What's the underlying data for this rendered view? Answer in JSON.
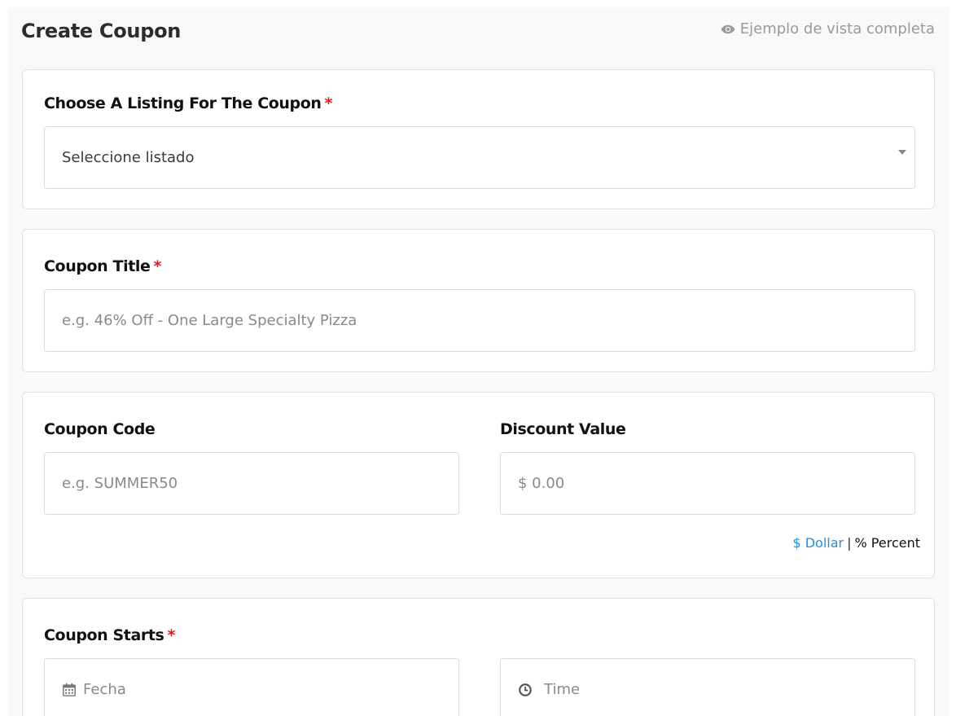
{
  "header": {
    "title": "Create Coupon",
    "preview_label": "Ejemplo de vista completa"
  },
  "listing": {
    "label": "Choose A Listing For The Coupon",
    "required_mark": "*",
    "selected_value": "Seleccione listado"
  },
  "coupon_title": {
    "label": "Coupon Title",
    "required_mark": "*",
    "placeholder": "e.g. 46% Off -  One Large Specialty Pizza"
  },
  "coupon_code": {
    "label": "Coupon Code",
    "placeholder": "e.g. SUMMER50"
  },
  "discount": {
    "label": "Discount Value",
    "placeholder": "$ 0.00",
    "unit_dollar": "$ Dollar",
    "unit_separator": "|",
    "unit_percent": "% Percent",
    "accent_color": "#1e90e8"
  },
  "coupon_starts": {
    "label": "Coupon Starts",
    "required_mark": "*",
    "date_placeholder": "Fecha",
    "date_icon": "calendar-icon",
    "time_placeholder": "Time",
    "time_icon": "clock-icon"
  },
  "colors": {
    "required": "#e31b1b",
    "link": "#1e90e8",
    "border": "#dfe1e4"
  }
}
